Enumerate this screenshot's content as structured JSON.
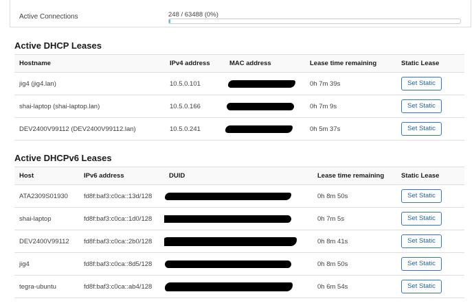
{
  "connections": {
    "label": "Active Connections",
    "value": "248 / 63488 (0%)",
    "progress_fraction": 0.0039
  },
  "dhcp": {
    "title": "Active DHCP Leases",
    "headers": [
      "Hostname",
      "IPv4 address",
      "MAC address",
      "Lease time remaining",
      "Static Lease"
    ],
    "rows": [
      {
        "hostname": "jig4 (jig4.lan)",
        "ipv4": "10.5.0.101",
        "lease": "0h 7m 39s"
      },
      {
        "hostname": "shai-laptop (shai-laptop.lan)",
        "ipv4": "10.5.0.166",
        "lease": "0h 7m 9s"
      },
      {
        "hostname": "DEV2400V99112 (DEV2400V99112.lan)",
        "ipv4": "10.5.0.241",
        "lease": "0h 5m 37s"
      }
    ]
  },
  "dhcpv6": {
    "title": "Active DHCPv6 Leases",
    "headers": [
      "Host",
      "IPv6 address",
      "DUID",
      "Lease time remaining",
      "Static Lease"
    ],
    "rows": [
      {
        "host": "ATA2309S01930",
        "ipv6": "fd8f:baf3:c0ca::13d/128",
        "lease": "0h 8m 50s"
      },
      {
        "host": "shai-laptop",
        "ipv6": "fd8f:baf3:c0ca::1d0/128",
        "lease": "0h 7m 5s"
      },
      {
        "host": "DEV2400V99112",
        "ipv6": "fd8f:baf3:c0ca::2b0/128",
        "lease": "0h 8m 41s"
      },
      {
        "host": "jig4",
        "ipv6": "fd8f:baf3:c0ca::8d5/128",
        "lease": "0h 8m 50s"
      },
      {
        "host": "tegra-ubuntu",
        "ipv6": "fd8f:baf3:c0ca::ab4/128",
        "lease": "0h 6m 54s"
      }
    ]
  },
  "buttons": {
    "set_static": "Set Static"
  },
  "colors": {
    "progress": "#5bc0de",
    "button_border": "#2f76c6",
    "button_text": "#1f5fa6"
  }
}
